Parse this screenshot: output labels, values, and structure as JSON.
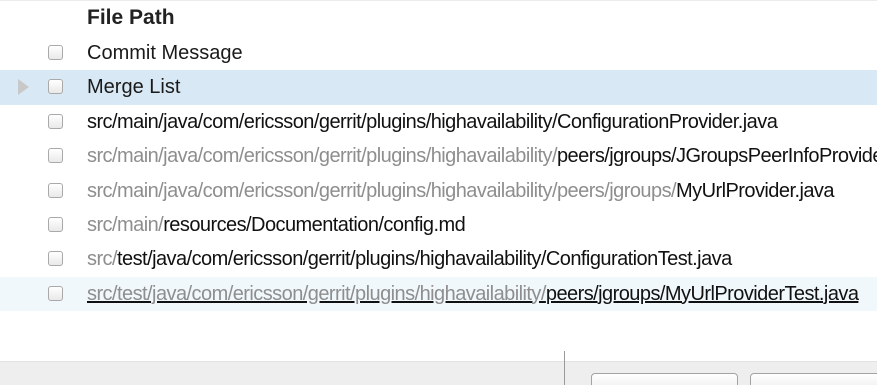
{
  "table": {
    "header": "File Path",
    "rows": [
      {
        "label": "Commit Message"
      },
      {
        "label": "Merge List"
      }
    ],
    "paths": [
      {
        "dim": "",
        "strong": "src/main/java/com/ericsson/gerrit/plugins/highavailability/ConfigurationProvider.java"
      },
      {
        "dim": "src/main/java/com/ericsson/gerrit/plugins/highavailability/",
        "strong": "peers/jgroups/JGroupsPeerInfoProvider.java"
      },
      {
        "dim": "src/main/java/com/ericsson/gerrit/plugins/highavailability/peers/jgroups/",
        "strong": "MyUrlProvider.java"
      },
      {
        "dim": "src/main/",
        "strong": "resources/Documentation/config.md"
      },
      {
        "dim": "src/",
        "strong": "test/java/com/ericsson/gerrit/plugins/highavailability/ConfigurationTest.java"
      },
      {
        "dim": "src/test/java/com/ericsson/gerrit/plugins/highavailability/",
        "strong": "peers/jgroups/MyUrlProviderTest.java"
      }
    ]
  }
}
